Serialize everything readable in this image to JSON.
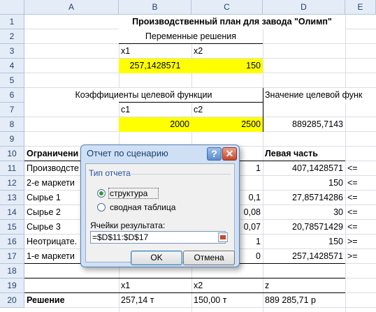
{
  "columns": [
    "A",
    "B",
    "C",
    "D",
    "E"
  ],
  "rows": [
    "1",
    "2",
    "3",
    "4",
    "5",
    "6",
    "7",
    "8",
    "9",
    "10",
    "11",
    "12",
    "13",
    "14",
    "15",
    "16",
    "17",
    "18",
    "19",
    "20"
  ],
  "cells": {
    "title": "Производственный план для завода \"Олимп\"",
    "vars_header": "Переменные решения",
    "x1": "x1",
    "x2": "x2",
    "x1_val": "257,1428571",
    "x2_val": "150",
    "coef_header": "Коэффициенты целевой функции",
    "obj_header": "Значение целевой функ",
    "c1": "c1",
    "c2": "c2",
    "c1_val": "2000",
    "c2_val": "2500",
    "obj_val": "889285,7143",
    "constraints_label": "Ограничени",
    "lhs_header": "Левая часть",
    "constraint_rows": [
      {
        "name": "Производсте",
        "c": "1",
        "d": "407,1428571",
        "e": "<="
      },
      {
        "name": "2-е маркети",
        "c": "",
        "d": "150",
        "e": "<="
      },
      {
        "name": "Сырье 1",
        "c": "0,1",
        "d": "27,85714286",
        "e": "<="
      },
      {
        "name": "Сырье 2",
        "c": "0,08",
        "d": "30",
        "e": "<="
      },
      {
        "name": "Сырье 3",
        "c": "0,07",
        "d": "20,78571429",
        "e": "<="
      },
      {
        "name": "Неотрицате.",
        "c": "1",
        "d": "150",
        "e": ">="
      },
      {
        "name": "1-е маркети",
        "c": "0",
        "d": "257,1428571",
        "e": ">="
      }
    ],
    "x1_b": "x1",
    "x2_b": "x2",
    "z": "z",
    "solution_label": "Решение",
    "sol_x1": "257,14 т",
    "sol_x2": "150,00 т",
    "sol_z": "889 285,71 р"
  },
  "dialog": {
    "title": "Отчет по сценарию",
    "help": "?",
    "close": "✕",
    "group_label": "Тип отчета",
    "option_structure": "структура",
    "option_pivot": "сводная таблица",
    "result_label": "Ячейки результата:",
    "result_value": "=$D$11:$D$17",
    "ok": "OK",
    "cancel": "Отмена"
  }
}
